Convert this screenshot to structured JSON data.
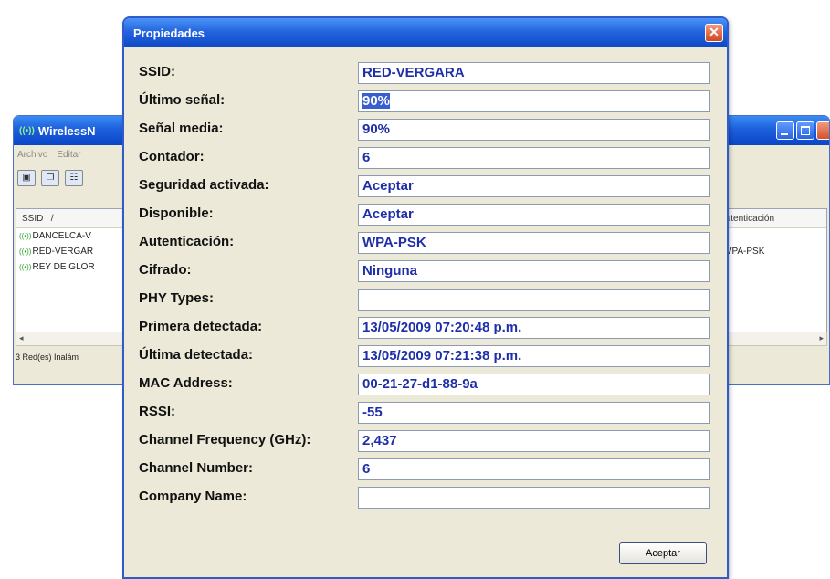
{
  "main_window": {
    "title": "WirelessN",
    "menu": [
      "Archivo",
      "Editar"
    ],
    "columns": {
      "ssid": "SSID",
      "sort_indicator": "/",
      "auth": "Autenticación"
    },
    "rows": [
      {
        "ssid": "DANCELCA-V",
        "auth": ""
      },
      {
        "ssid": "RED-VERGAR",
        "auth": "WPA-PSK"
      },
      {
        "ssid": "REY DE GLOR",
        "auth": ""
      }
    ],
    "status": "3 Red(es) Inalám"
  },
  "dialog": {
    "title": "Propiedades",
    "close_glyph": "✕",
    "ok_label": "Aceptar",
    "properties": [
      {
        "label": "SSID:",
        "value": "RED-VERGARA"
      },
      {
        "label": "Último señal:",
        "value": "90%",
        "selected": true
      },
      {
        "label": "Señal media:",
        "value": "90%"
      },
      {
        "label": "Contador:",
        "value": "6"
      },
      {
        "label": "Seguridad activada:",
        "value": "Aceptar"
      },
      {
        "label": "Disponible:",
        "value": "Aceptar"
      },
      {
        "label": "Autenticación:",
        "value": "WPA-PSK"
      },
      {
        "label": "Cifrado:",
        "value": "Ninguna"
      },
      {
        "label": "PHY Types:",
        "value": ""
      },
      {
        "label": "Primera detectada:",
        "value": "13/05/2009 07:20:48 p.m."
      },
      {
        "label": "Última detectada:",
        "value": "13/05/2009 07:21:38 p.m."
      },
      {
        "label": "MAC Address:",
        "value": "00-21-27-d1-88-9a"
      },
      {
        "label": "RSSI:",
        "value": "-55"
      },
      {
        "label": "Channel Frequency (GHz):",
        "value": "2,437"
      },
      {
        "label": "Channel Number:",
        "value": "6"
      },
      {
        "label": "Company Name:",
        "value": ""
      }
    ]
  },
  "colors": {
    "title_bar": "#1d5fdc",
    "value_text": "#1e2fa8",
    "selection": "#3a5ed0",
    "close_button": "#d0461f"
  },
  "icons": {
    "wifi": "wifi-signal-icon",
    "save": "save-icon",
    "copy": "copy-icon",
    "properties": "properties-icon"
  }
}
